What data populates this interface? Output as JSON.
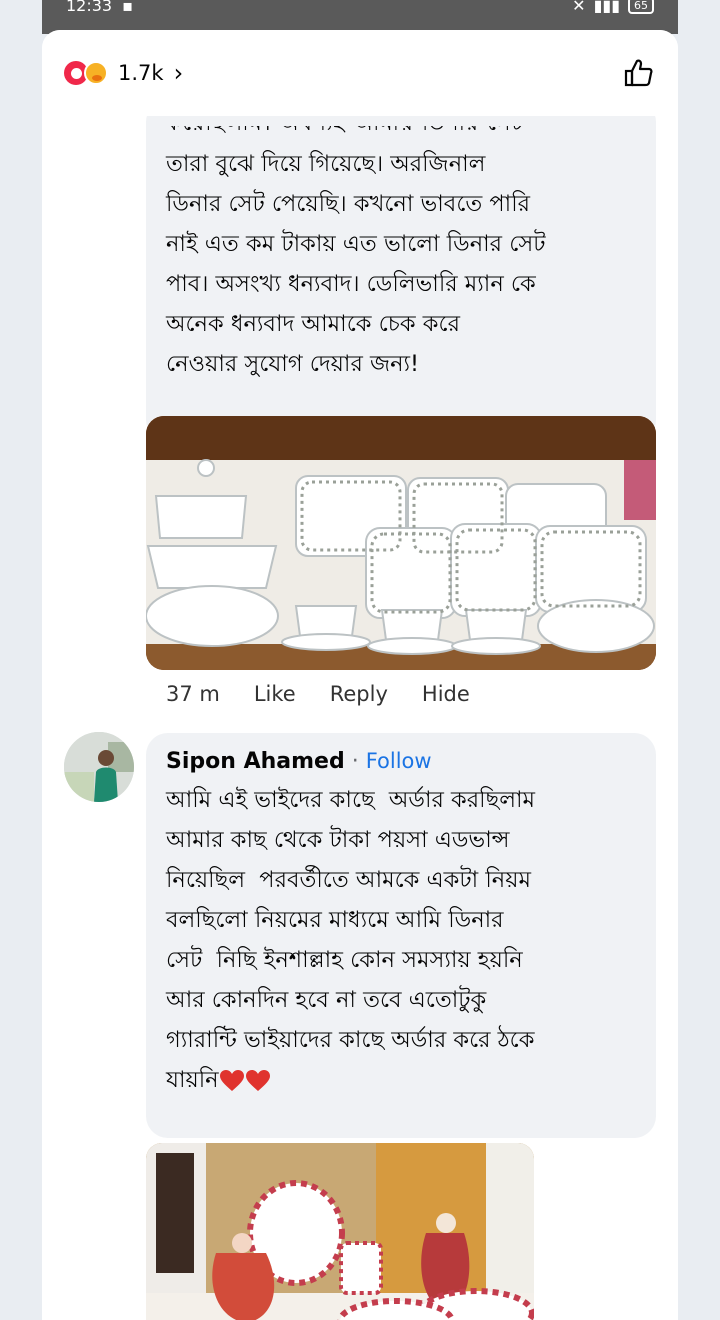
{
  "status_bar": {
    "time": "12:33",
    "battery": "65"
  },
  "header": {
    "reaction_count": "1.7k",
    "chevron": "›"
  },
  "comment1": {
    "partial_line": "কয়েছিলাম। অবশ্যই আমায় ডিনার সেট",
    "text": "তারা বুঝে দিয়ে গিয়েছে। অরজিনাল\nডিনার সেট পেয়েছি। কখনো ভাবতে পারি\nনাই এত কম টাকায় এত ভালো ডিনার সেট\nপাব। অসংখ্য ধন্যবাদ। ডেলিভারি ম্যান কে\nঅনেক ধন্যবাদ আমাকে চেক করে\nনেওয়ার সুযোগ দেয়ার জন্য!",
    "meta": {
      "time": "37 m",
      "like": "Like",
      "reply": "Reply",
      "hide": "Hide"
    }
  },
  "comment2": {
    "author": "Sipon Ahamed",
    "separator": "·",
    "follow": "Follow",
    "text": "আমি এই ভাইদের কাছে  অর্ডার করছিলাম\nআমার কাছ থেকে টাকা পয়সা এডভান্স\nনিয়েছিল  পরবর্তীতে আমকে একটা নিয়ম\nবলছিলো নিয়মের মাধ্যমে আমি ডিনার\nসেট  নিছি ইনশাল্লাহ কোন সমস্যায় হয়নি\nআর কোনদিন হবে না তবে এতোটুকু\nগ্যারান্টি ভাইয়াদের কাছে অর্ডার করে ঠকে\nযায়নি"
  },
  "colors": {
    "link_blue": "#1b74e4",
    "bubble_gray": "#f0f2f5",
    "heart_red": "#f0284a"
  }
}
